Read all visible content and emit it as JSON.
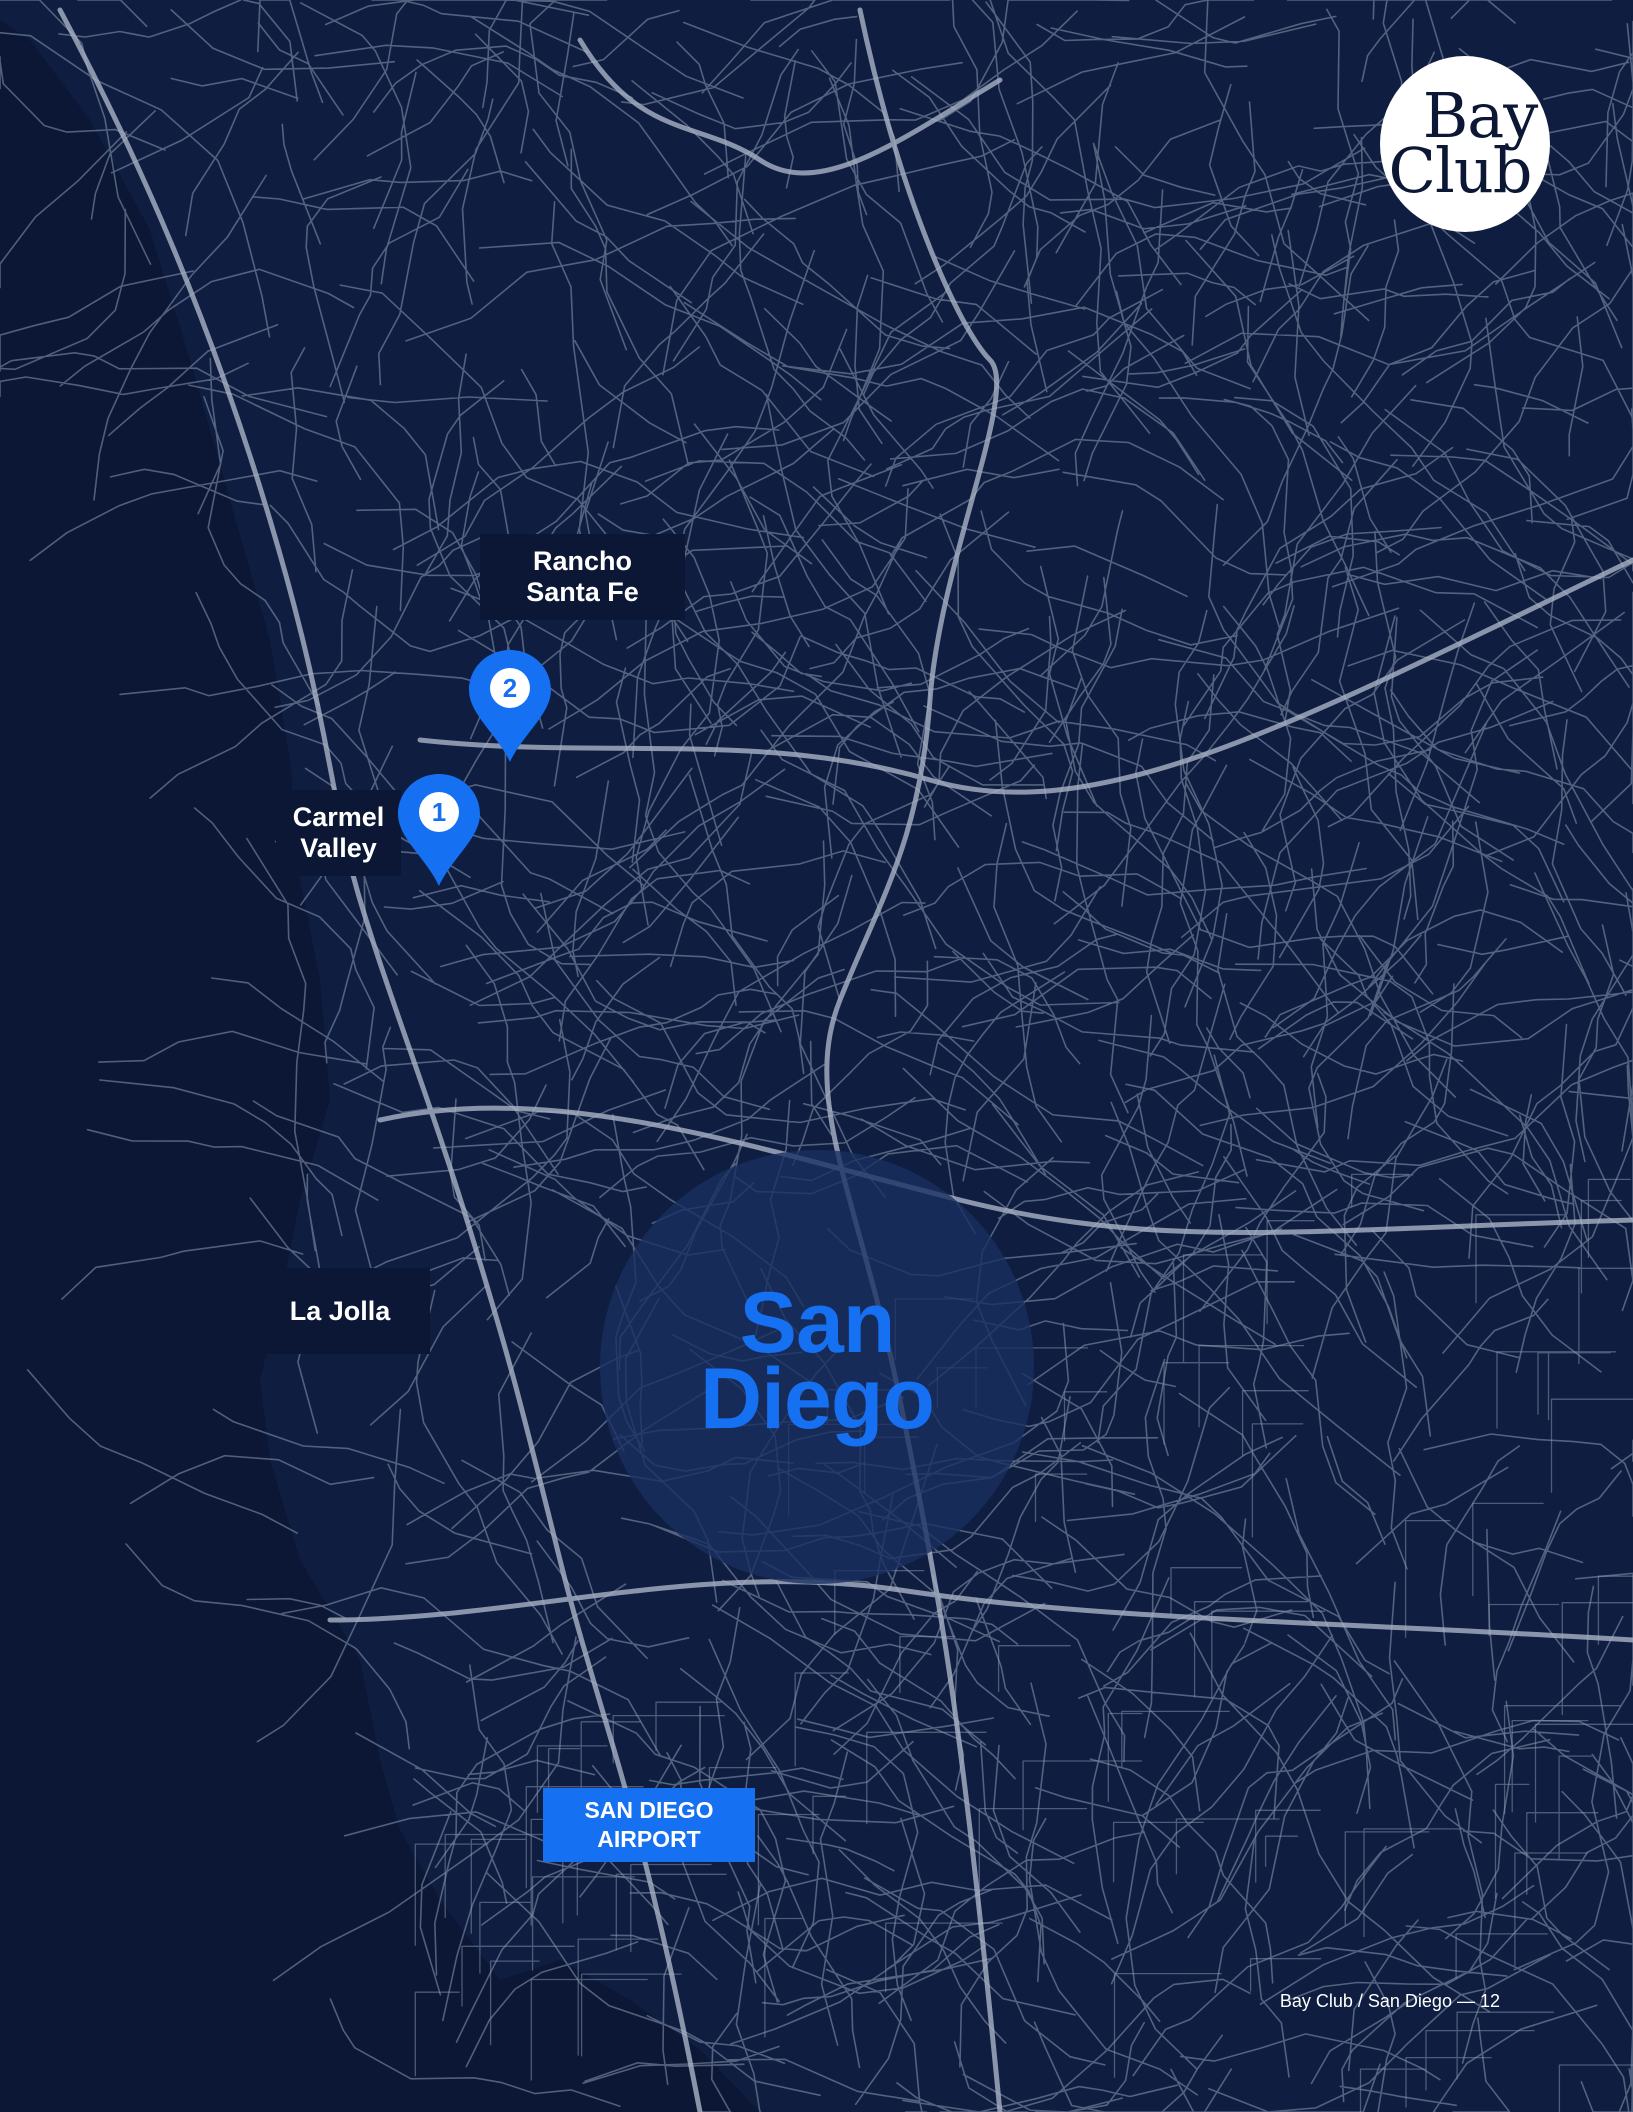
{
  "brand": {
    "line1": "Bay",
    "line2": "Club"
  },
  "labels": {
    "rancho_santa_fe": "Rancho\nSanta Fe",
    "carmel_valley": "Carmel\nValley",
    "la_jolla": "La Jolla"
  },
  "pins": [
    {
      "number": "1"
    },
    {
      "number": "2"
    }
  ],
  "city": "San\nDiego",
  "airport": "SAN DIEGO\nAIRPORT",
  "footer": {
    "brand": "Bay Club",
    "location": "San Diego",
    "page": "12"
  },
  "colors": {
    "background": "#0b1735",
    "roads": "#8d9bb3",
    "accent": "#1570f2",
    "label_text": "#ffffff"
  }
}
